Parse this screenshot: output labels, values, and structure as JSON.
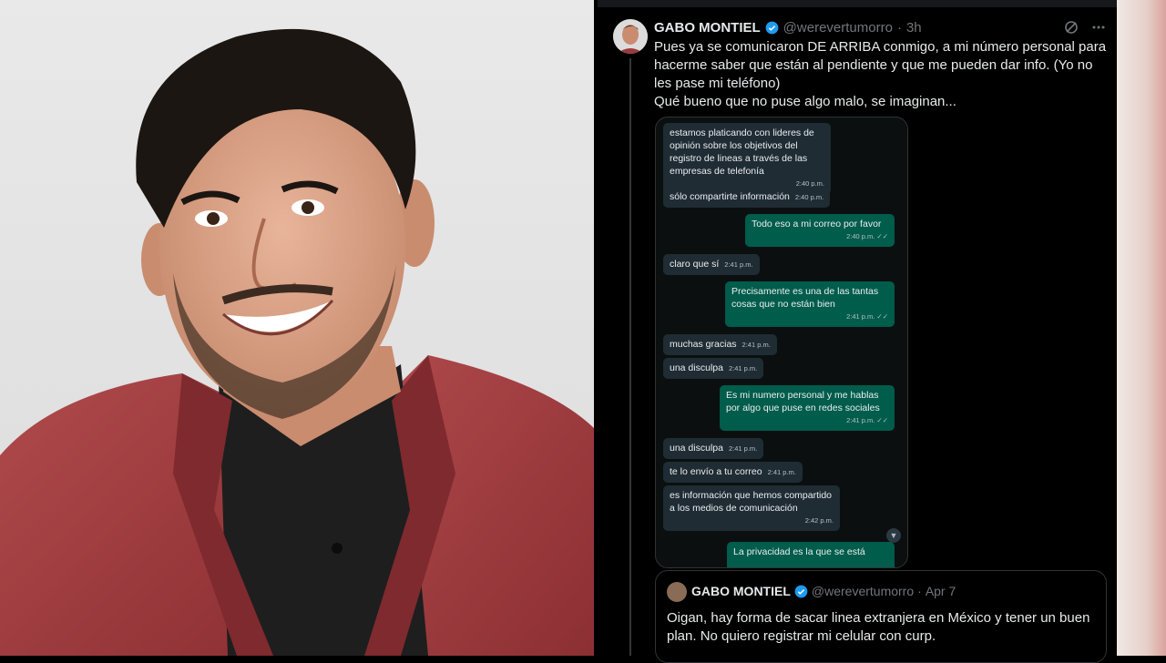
{
  "tweet": {
    "author_name": "GABO MONTIEL",
    "author_handle": "@werevertumorro",
    "separator": "·",
    "time": "3h",
    "text_line1": "Pues ya se comunicaron DE ARRIBA conmigo, a mi número personal para hacerme saber que están al pendiente y que me pueden dar info. (Yo no les pase mi teléfono)",
    "text_line2": "Qué bueno que no puse algo malo, se imaginan..."
  },
  "chat": {
    "messages": [
      {
        "dir": "in",
        "text": "estamos platicando con lideres de opinión sobre los objetivos del registro de lineas a través de las empresas de telefonía",
        "time": "2:40 p.m."
      },
      {
        "dir": "in",
        "text": "sólo compartirte información",
        "time": "2:40 p.m."
      },
      {
        "dir": "out",
        "text": "Todo eso a mi correo por favor",
        "time": "2:40 p.m. ✓✓"
      },
      {
        "dir": "in",
        "text": "claro que sí",
        "time": "2:41 p.m."
      },
      {
        "dir": "out",
        "text": "Precisamente es una de las tantas cosas que no están bien",
        "time": "2:41 p.m. ✓✓"
      },
      {
        "dir": "in",
        "text": "muchas gracias",
        "time": "2:41 p.m."
      },
      {
        "dir": "in",
        "text": "una disculpa",
        "time": "2:41 p.m."
      },
      {
        "dir": "out",
        "text": "Es mi numero personal y me hablas por algo que puse en redes sociales",
        "time": "2:41 p.m. ✓✓"
      },
      {
        "dir": "in",
        "text": "una disculpa",
        "time": "2:41 p.m."
      },
      {
        "dir": "in",
        "text": "te lo envío a tu correo",
        "time": "2:41 p.m."
      },
      {
        "dir": "in",
        "text": "es información que hemos compartido a los medios de comunicación",
        "time": "2:42 p.m."
      },
      {
        "dir": "out",
        "text": "La privacidad es la que se está",
        "time": ""
      }
    ]
  },
  "quote": {
    "author_name": "GABO MONTIEL",
    "author_handle": "@werevertumorro",
    "separator": "·",
    "date": "Apr 7",
    "text": "Oigan, hay forma de sacar linea extranjera en México y tener un buen plan. No quiero registrar mi celular con curp."
  },
  "icons": {
    "verified": "verified-badge-icon",
    "grok": "grok-icon",
    "more": "more-icon",
    "scroll": "chevron-down-icon"
  },
  "colors": {
    "verified_blue": "#1d9bf0",
    "incoming_bubble": "#1f2c33",
    "outgoing_bubble": "#005c4b",
    "blazer": "#9b3a3d"
  }
}
